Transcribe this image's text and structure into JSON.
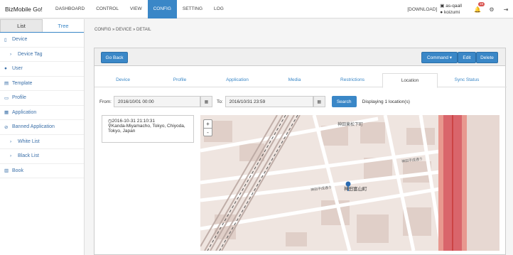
{
  "app": {
    "title": "BizMobile Go!"
  },
  "nav": [
    "DASHBOARD",
    "CONTROL",
    "VIEW",
    "CONFIG",
    "SETTING",
    "LOG"
  ],
  "topright": {
    "download": "[DOWNLOAD]",
    "user_line1": "as-qaall",
    "user_line2": "koizumi",
    "badge": "19"
  },
  "sidebar": {
    "tabs": [
      "List",
      "Tree"
    ],
    "items": [
      {
        "label": "Device",
        "icon": "mobile-icon"
      },
      {
        "label": "Device Tag",
        "icon": "chevron-right-icon"
      },
      {
        "label": "User",
        "icon": "user-icon"
      },
      {
        "label": "Template",
        "icon": "file-icon"
      },
      {
        "label": "Profile",
        "icon": "document-icon"
      },
      {
        "label": "Application",
        "icon": "grid-icon"
      },
      {
        "label": "Banned Application",
        "icon": "ban-icon"
      },
      {
        "label": "White List",
        "icon": "chevron-right-icon"
      },
      {
        "label": "Black List",
        "icon": "chevron-right-icon"
      },
      {
        "label": "Book",
        "icon": "book-icon"
      }
    ]
  },
  "breadcrumb": "CONFIG » DEVICE » DETAIL",
  "buttons": {
    "back": "Go Back",
    "command": "Command ▾",
    "edit": "Edit",
    "delete": "Delete"
  },
  "tabs": [
    "Device",
    "Profile",
    "Application",
    "Media",
    "Restrictions",
    "Location",
    "Sync Status"
  ],
  "filter": {
    "from_label": "From:",
    "from_value": "2016/10/01 00:00",
    "to_label": "To:",
    "to_value": "2016/10/31 23:59",
    "search": "Search",
    "status": "Displaying 1 location(s)"
  },
  "location": {
    "datetime": "2016-10-31 21:10:31",
    "address": "Kanda-Miyamacho, Tokyo, Chiyoda, Tokyo, Japan"
  },
  "map": {
    "marker_label": "神田富山町",
    "labels": [
      "神田東松下町",
      "神田平成通り",
      "神田平成通り"
    ],
    "zoom_in": "+",
    "zoom_out": "-"
  }
}
